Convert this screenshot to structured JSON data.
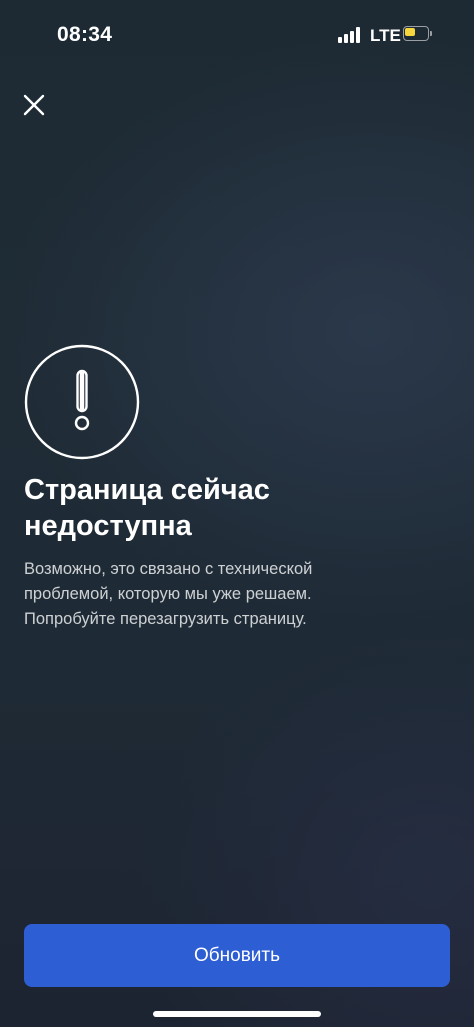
{
  "status_bar": {
    "time": "08:34",
    "network": "LTE",
    "battery_level": 0.55,
    "battery_color": "#f5d63d"
  },
  "header": {
    "close_icon": "close-icon"
  },
  "error": {
    "icon": "exclamation-circle-icon",
    "title_line1": "Страница сейчас",
    "title_line2": "недоступна",
    "message_line1": "Возможно, это связано с технической",
    "message_line2": "проблемой, которую мы уже решаем.",
    "message_line3": "Попробуйте перезагрузить страницу."
  },
  "actions": {
    "refresh_label": "Обновить",
    "accent_color": "#2d5ed4"
  }
}
